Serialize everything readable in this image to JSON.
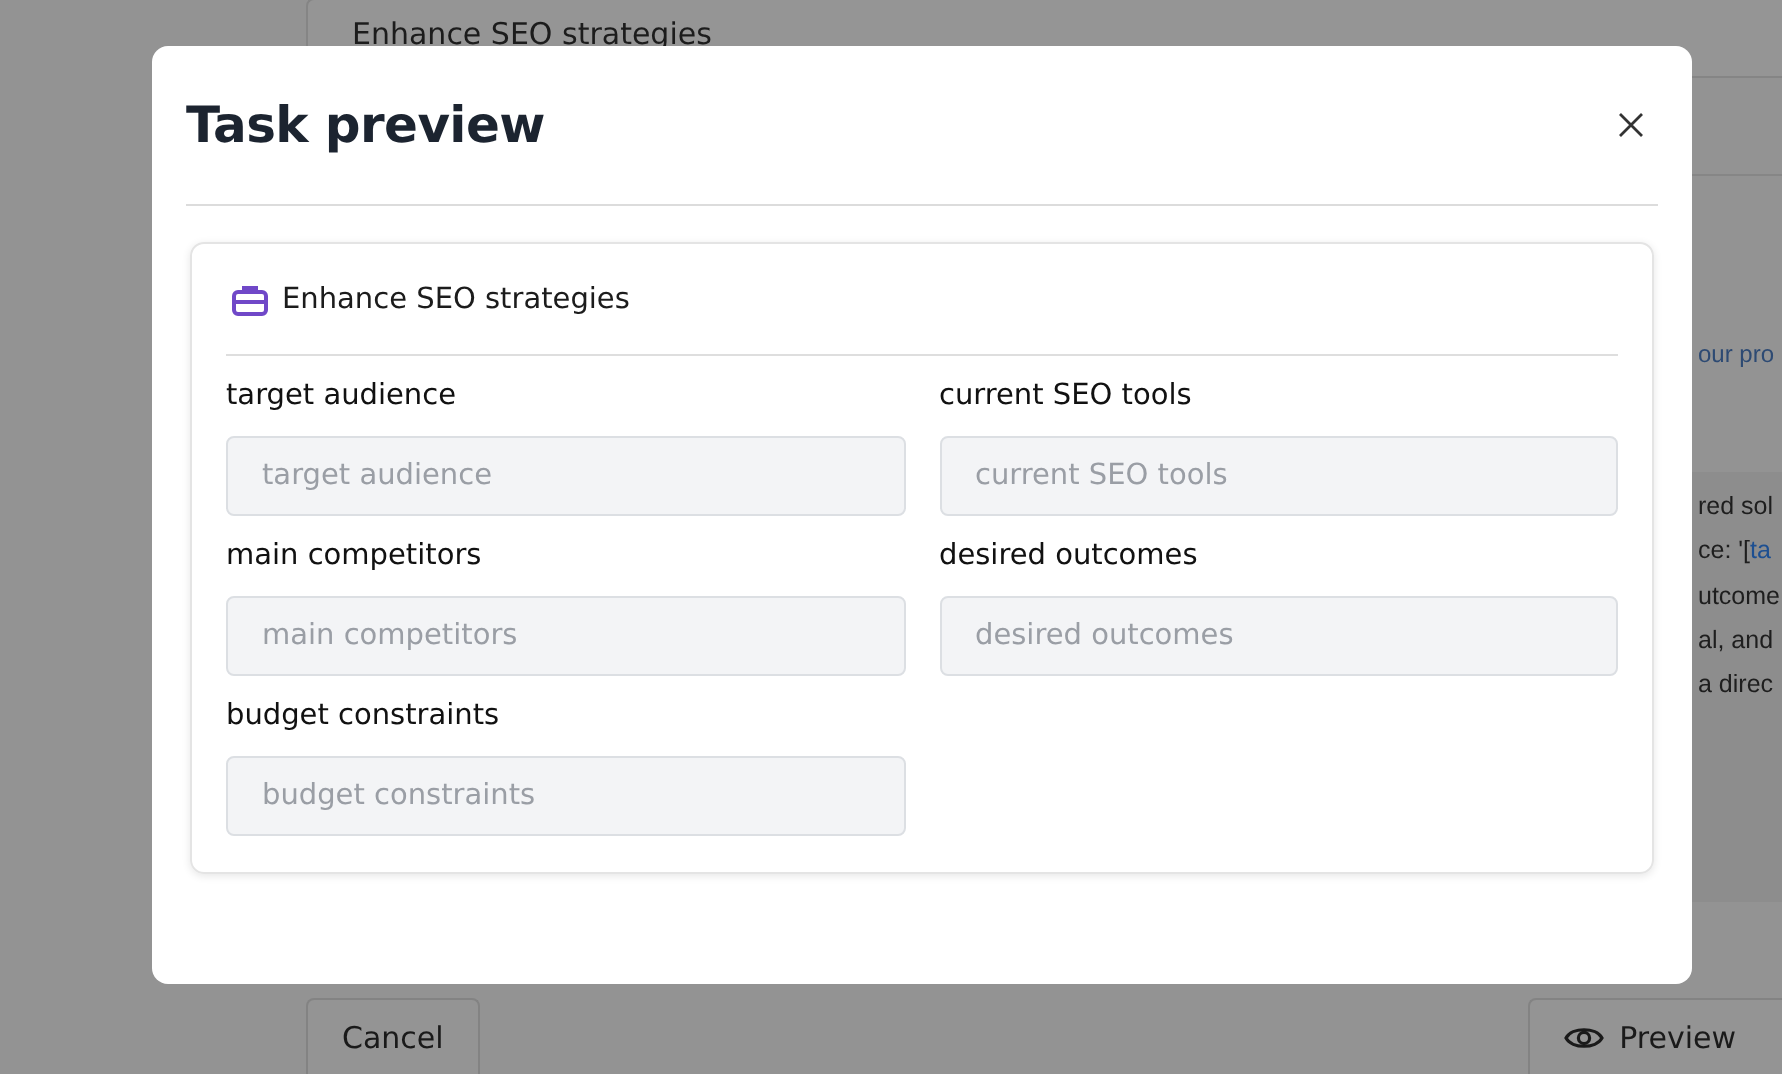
{
  "background": {
    "task_field": "Enhance SEO strategies",
    "hint_text": "our pro",
    "prompt_lines": [
      [
        {
          "text": "red sol",
          "kind": "plain"
        }
      ],
      [
        {
          "text": "ce: '[",
          "kind": "plain"
        },
        {
          "text": "ta",
          "kind": "variable"
        }
      ],
      [
        {
          "text": "utcome",
          "kind": "plain"
        }
      ],
      [
        {
          "text": "al, and",
          "kind": "plain"
        }
      ],
      [
        {
          "text": "a direc",
          "kind": "plain"
        }
      ]
    ],
    "cancel_button": "Cancel",
    "preview_button": "Preview"
  },
  "modal": {
    "title": "Task preview",
    "card_title": "Enhance SEO strategies",
    "fields": [
      {
        "label": "target audience",
        "placeholder": "target audience"
      },
      {
        "label": "current SEO tools",
        "placeholder": "current SEO tools"
      },
      {
        "label": "main competitors",
        "placeholder": "main competitors"
      },
      {
        "label": "desired outcomes",
        "placeholder": "desired outcomes"
      },
      {
        "label": "budget constraints",
        "placeholder": "budget constraints"
      }
    ]
  }
}
